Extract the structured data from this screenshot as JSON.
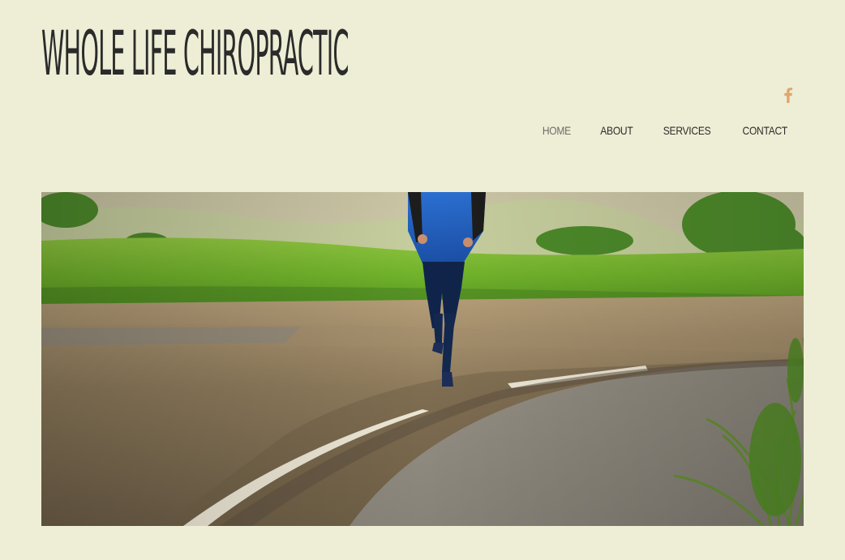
{
  "header": {
    "site_title": "WHOLE LIFE CHIROPRACTIC",
    "social": {
      "icon": "facebook-icon",
      "color": "#e0a56a"
    }
  },
  "nav": {
    "items": [
      {
        "label": "HOME",
        "active": true
      },
      {
        "label": "ABOUT",
        "active": false
      },
      {
        "label": "SERVICES",
        "active": false
      },
      {
        "label": "CONTACT",
        "active": false
      }
    ]
  },
  "hero": {
    "image": "runner-on-road-photo"
  },
  "colors": {
    "background": "#eeeed6",
    "text": "#2b2b2b",
    "nav_active": "#6b6b6b",
    "accent": "#e0a56a"
  }
}
